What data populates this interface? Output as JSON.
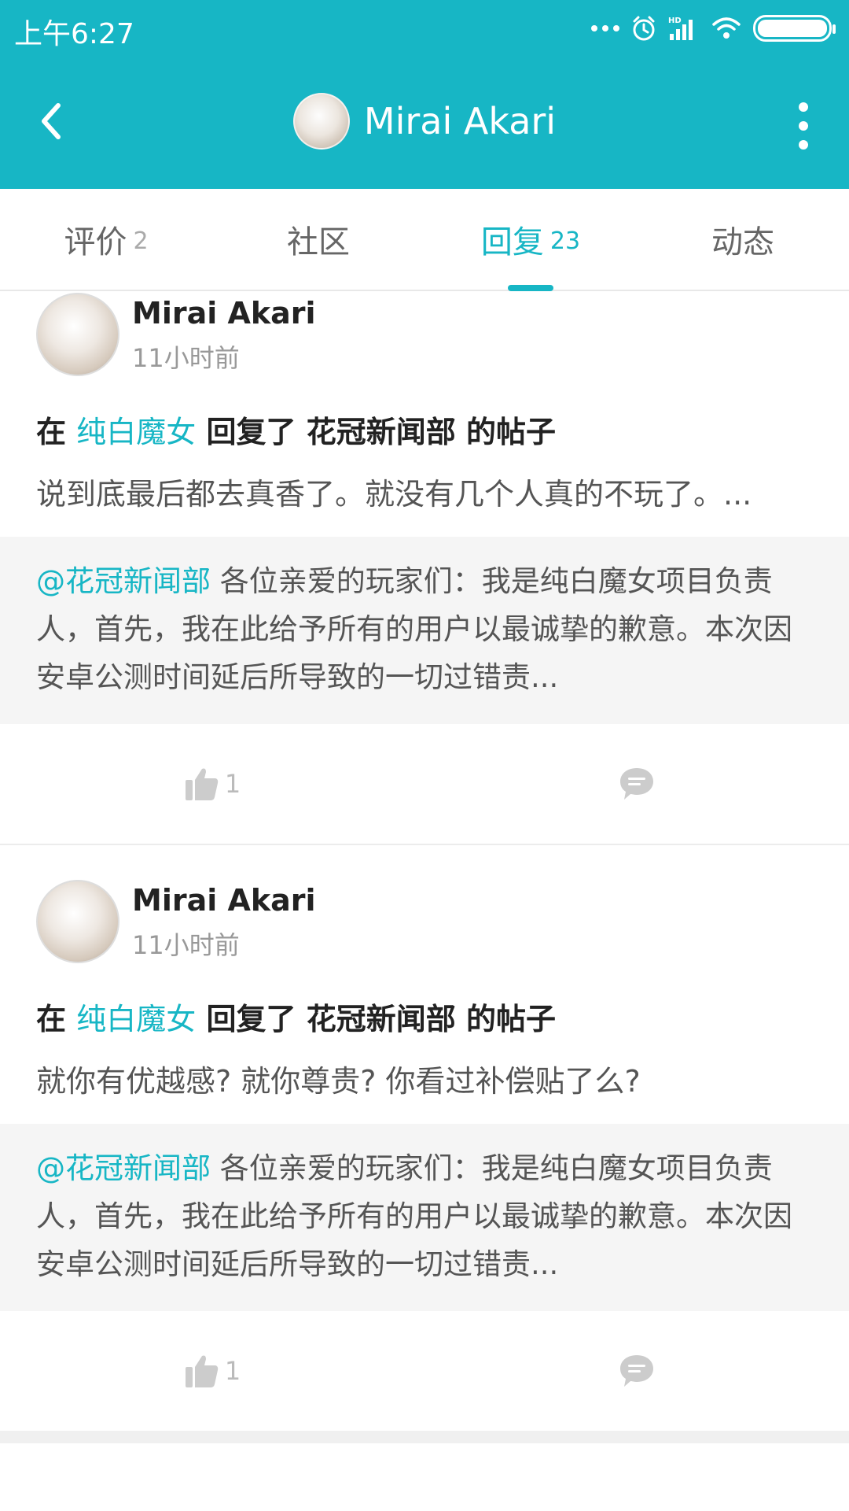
{
  "status_bar": {
    "time": "上午6:27",
    "icons": [
      "more-dots-icon",
      "alarm-icon",
      "hd-signal-icon",
      "wifi-icon",
      "battery-icon"
    ]
  },
  "header": {
    "title": "Mirai Akari",
    "back_icon": "chevron-left-icon",
    "more_icon": "more-vertical-icon",
    "background": "#17b6c5"
  },
  "tabs": [
    {
      "label": "评价",
      "count": "2",
      "active": false
    },
    {
      "label": "社区",
      "count": "",
      "active": false
    },
    {
      "label": "回复",
      "count": "23",
      "active": true
    },
    {
      "label": "动态",
      "count": "",
      "active": false
    }
  ],
  "accent_color": "#17b6c5",
  "posts": [
    {
      "author": "Mirai Akari",
      "time": "11小时前",
      "headline": {
        "prefix": "在",
        "game_link": "纯白魔女",
        "middle": "回复了",
        "target": "花冠新闻部",
        "suffix": "的帖子"
      },
      "content": "说到底最后都去真香了。就没有几个人真的不玩了。...",
      "quote": {
        "mention": "@花冠新闻部",
        "text": " 各位亲爱的玩家们：我是纯白魔女项目负责人，首先，我在此给予所有的用户以最诚挚的歉意。本次因安卓公测时间延后所导致的一切过错责..."
      },
      "likes": "1",
      "like_icon": "thumbs-up-icon",
      "comment_icon": "comment-icon"
    },
    {
      "author": "Mirai Akari",
      "time": "11小时前",
      "headline": {
        "prefix": "在",
        "game_link": "纯白魔女",
        "middle": "回复了",
        "target": "花冠新闻部",
        "suffix": "的帖子"
      },
      "content": "就你有优越感? 就你尊贵? 你看过补偿贴了么?",
      "quote": {
        "mention": "@花冠新闻部",
        "text": " 各位亲爱的玩家们：我是纯白魔女项目负责人，首先，我在此给予所有的用户以最诚挚的歉意。本次因安卓公测时间延后所导致的一切过错责..."
      },
      "likes": "1",
      "like_icon": "thumbs-up-icon",
      "comment_icon": "comment-icon"
    }
  ]
}
